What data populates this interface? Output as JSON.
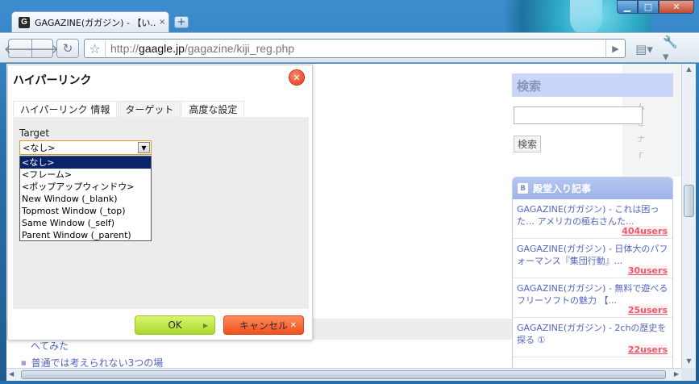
{
  "browser": {
    "tab_title": "GAGAZINE(ガガジン) - 【い...",
    "tab_favicon_letter": "G",
    "tab_close": "×",
    "newtab_symbol": "+",
    "url_host": "gaagle.jp",
    "url_prefix": "http://",
    "url_path": "/gagazine/kiji_reg.php"
  },
  "dialog": {
    "title": "ハイパーリンク",
    "tabs": [
      {
        "label": "ハイパーリンク 情報",
        "active": false
      },
      {
        "label": "ターゲット",
        "active": true
      },
      {
        "label": "高度な設定",
        "active": false
      }
    ],
    "target_label": "Target",
    "select_value": "<なし>",
    "options": [
      "<なし>",
      "<フレーム>",
      "<ポップアップウィンドウ>",
      "New Window (_blank)",
      "Topmost Window (_top)",
      "Same Window (_self)",
      "Parent Window (_parent)"
    ],
    "selected_index": 0,
    "ok_label": "OK",
    "cancel_label": "キャンセル"
  },
  "page": {
    "under_text": "へてみた",
    "under_list_item": "普通では考えられない3つの場"
  },
  "sidebar": {
    "search_heading": "検索",
    "search_button": "検索",
    "hall_heading": "殿堂入り記事",
    "hall_icon": "B",
    "entries": [
      {
        "title": "GAGAZINE(ガガジン) - これは困った… アメリカの極右さんた...",
        "users": "404users"
      },
      {
        "title": "GAGAZINE(ガガジン) - 日体大のパフォーマンス『集団行動』...",
        "users": "30users"
      },
      {
        "title": "GAGAZINE(ガガジン) - 無料で遊べるフリーソフトの魅力 【...",
        "users": "25users"
      },
      {
        "title": "GAGAZINE(ガガジン) - 2chの歴史を探る ①",
        "users": "22users"
      }
    ]
  },
  "colors": {
    "accent_link": "#5264c2",
    "users_red": "#e85c6b",
    "ok_green": "#a9d92c",
    "cancel_orange": "#f0501e",
    "selected_option": "#0a246a"
  }
}
